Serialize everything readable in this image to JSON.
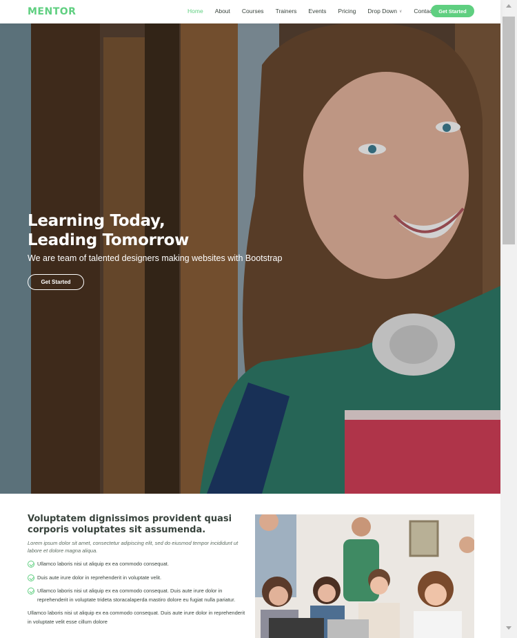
{
  "header": {
    "logo": "MENTOR",
    "nav": [
      {
        "label": "Home",
        "active": true
      },
      {
        "label": "About"
      },
      {
        "label": "Courses"
      },
      {
        "label": "Trainers"
      },
      {
        "label": "Events"
      },
      {
        "label": "Pricing"
      },
      {
        "label": "Drop Down",
        "dropdown": true
      },
      {
        "label": "Contact"
      }
    ],
    "cta": "Get Started"
  },
  "hero": {
    "title_line1": "Learning Today,",
    "title_line2": "Leading Tomorrow",
    "subtitle": "We are team of talented designers making websites with Bootstrap",
    "button": "Get Started"
  },
  "about": {
    "title": "Voluptatem dignissimos provident quasi corporis voluptates sit assumenda.",
    "italic": "Lorem ipsum dolor sit amet, consectetur adipiscing elit, sed do eiusmod tempor incididunt ut labore et dolore magna aliqua.",
    "items": [
      "Ullamco laboris nisi ut aliquip ex ea commodo consequat.",
      "Duis aute irure dolor in reprehenderit in voluptate velit.",
      "Ullamco laboris nisi ut aliquip ex ea commodo consequat. Duis aute irure dolor in reprehenderit in voluptate trideta storacalaperda mastiro dolore eu fugiat nulla pariatur."
    ],
    "paragraph": "Ullamco laboris nisi ut aliquip ex ea commodo consequat. Duis aute irure dolor in reprehenderit in voluptate velit esse cillum dolore"
  },
  "colors": {
    "accent": "#5fcf80",
    "text": "#37423b"
  }
}
